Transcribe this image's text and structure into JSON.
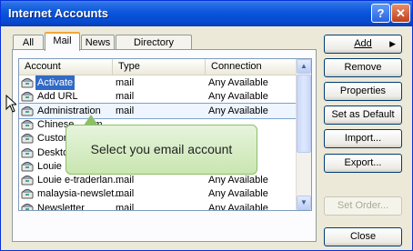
{
  "window": {
    "title": "Internet Accounts",
    "help_icon": "?",
    "close_icon": "✕"
  },
  "tabs": [
    {
      "label": "All"
    },
    {
      "label": "Mail",
      "active": true
    },
    {
      "label": "News"
    },
    {
      "label": "Directory Service"
    }
  ],
  "list": {
    "columns": [
      "Account",
      "Type",
      "Connection"
    ],
    "rows": [
      {
        "name": "Activate",
        "type": "mail",
        "connection": "Any Available"
      },
      {
        "name": "Add URL",
        "type": "mail",
        "connection": "Any Available"
      },
      {
        "name": "Administration",
        "type": "mail",
        "connection": "Any Available"
      },
      {
        "name": "Chinese ...rum",
        "type": "",
        "connection": ""
      },
      {
        "name": "Custome...",
        "type": "",
        "connection": ""
      },
      {
        "name": "Desktop...",
        "type": "",
        "connection": ""
      },
      {
        "name": "Louie",
        "type": "",
        "connection": ""
      },
      {
        "name": "Louie e-traderlan...",
        "type": "mail",
        "connection": "Any Available"
      },
      {
        "name": "malaysia-newslet...",
        "type": "mail",
        "connection": "Any Available"
      },
      {
        "name": "Newsletter",
        "type": "mail",
        "connection": "Any Available"
      }
    ],
    "selected_index": 0,
    "focused_index": 2
  },
  "buttons": {
    "add": "Add",
    "remove": "Remove",
    "properties": "Properties",
    "set_default": "Set as Default",
    "import": "Import...",
    "export": "Export...",
    "set_order": "Set Order...",
    "close": "Close"
  },
  "tooltip": {
    "text": "Select you email account"
  },
  "colors": {
    "titlebar": "#0a56dc",
    "selection": "#316ac5",
    "tooltip_bg": "#d6edc4",
    "window_bg": "#ece9d8"
  }
}
